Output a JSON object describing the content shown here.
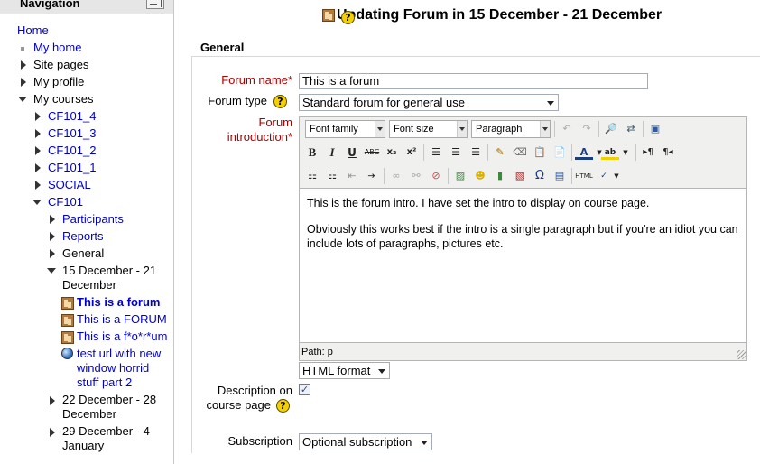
{
  "nav": {
    "title": "Navigation",
    "home": "Home",
    "my_home": "My home",
    "site_pages": "Site pages",
    "my_profile": "My profile",
    "my_courses": "My courses",
    "courses": [
      "CF101_4",
      "CF101_3",
      "CF101_2",
      "CF101_1",
      "SOCIAL"
    ],
    "cf101": "CF101",
    "participants": "Participants",
    "reports": "Reports",
    "general": "General",
    "week1_line1": "15 December - 21",
    "week1_line2": "December",
    "forum_current": "This is a forum",
    "forum_caps": "This is a FORUM",
    "forum_symbols": "This is a f*o*r*um",
    "url_line1": "test url with new",
    "url_line2": "window horrid",
    "url_line3": "stuff part 2",
    "week2_line1": "22 December - 28",
    "week2_line2": "December",
    "week3_line1": "29 December - 4",
    "week3_line2": "January"
  },
  "page": {
    "heading": "Updating Forum in 15 December - 21 December",
    "help_glyph": "?"
  },
  "form": {
    "legend": "General",
    "forum_name_label": "Forum name",
    "forum_name_value": "This is a forum",
    "forum_type_label": "Forum type",
    "forum_type_value": "Standard forum for general use",
    "intro_label_line1": "Forum",
    "intro_label_line2": "introduction",
    "required_mark": "*",
    "format_value": "HTML format",
    "desc_label_line1": "Description on",
    "desc_label_line2": "course page",
    "desc_checked": true,
    "check_glyph": "✓",
    "subscription_label": "Subscription",
    "subscription_value": "Optional subscription"
  },
  "editor": {
    "font_family": "Font family",
    "font_size": "Font size",
    "paragraph": "Paragraph",
    "body_p1": "This is the forum intro. I have set the intro to display on course page.",
    "body_p2": "Obviously this works best if the intro is a single paragraph but if you're an idiot you can include lots of paragraphs, pictures etc.",
    "path": "Path: p",
    "buttons": {
      "bold": "B",
      "italic": "I",
      "underline": "U",
      "strike": "ABC",
      "sub": "x₂",
      "sup": "x²",
      "omega": "Ω",
      "html": "HTML"
    }
  }
}
